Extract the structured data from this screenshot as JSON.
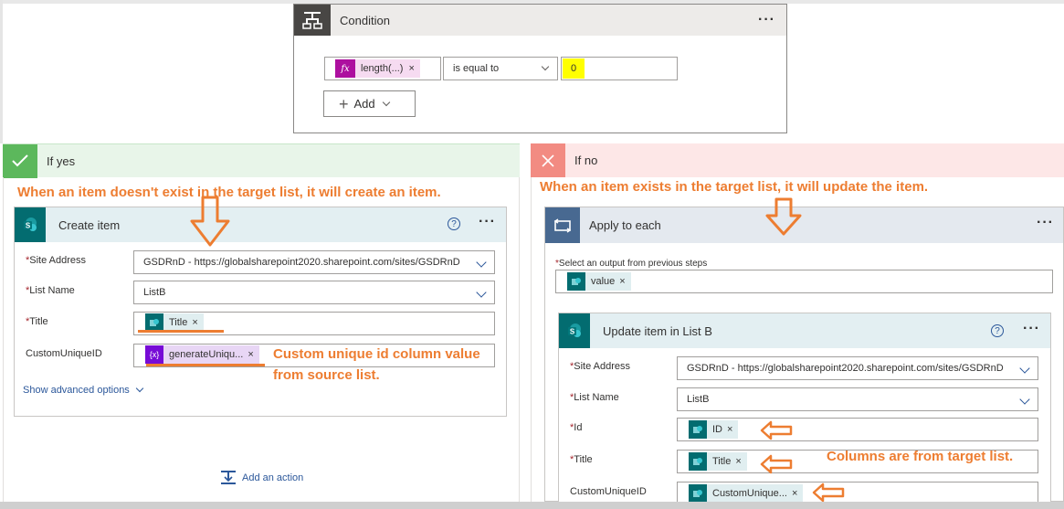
{
  "condition": {
    "title": "Condition",
    "expression_token": "length(...)",
    "operator": "is equal to",
    "value": "0",
    "add_label": "Add",
    "highlight_color": "#ffff00"
  },
  "branches": {
    "yes_label": "If yes",
    "no_label": "If no"
  },
  "annotations": {
    "yes_note": "When an item doesn't exist in the target list, it will create an item.",
    "no_note": "When an item exists in the target list, it will update the item.",
    "custom_id_note_1": "Custom unique id column value",
    "custom_id_note_2": "from source list.",
    "target_cols_note": "Columns are from target list."
  },
  "create_item": {
    "title": "Create item",
    "site_label": "Site Address",
    "site_value": "GSDRnD - https://globalsharepoint2020.sharepoint.com/sites/GSDRnD",
    "list_label": "List Name",
    "list_value": "ListB",
    "title_label": "Title",
    "title_token": "Title",
    "custom_label": "CustomUniqueID",
    "custom_token": "generateUniqu...",
    "advanced_link": "Show advanced options"
  },
  "add_action": "Add an action",
  "apply_each": {
    "title": "Apply to each",
    "select_label": "Select an output from previous steps",
    "value_token": "value"
  },
  "update_item": {
    "title": "Update item in List B",
    "site_label": "Site Address",
    "site_value": "GSDRnD - https://globalsharepoint2020.sharepoint.com/sites/GSDRnD",
    "list_label": "List Name",
    "list_value": "ListB",
    "id_label": "Id",
    "id_token": "ID",
    "title_label": "Title",
    "title_token": "Title",
    "custom_label": "CustomUniqueID",
    "custom_token": "CustomUnique..."
  },
  "colors": {
    "sharepoint": "#036c70",
    "accent_orange": "#ed7d31",
    "fx_token": "#ad0f9f",
    "var_token": "#770bd6",
    "link_blue": "#2b579a"
  }
}
